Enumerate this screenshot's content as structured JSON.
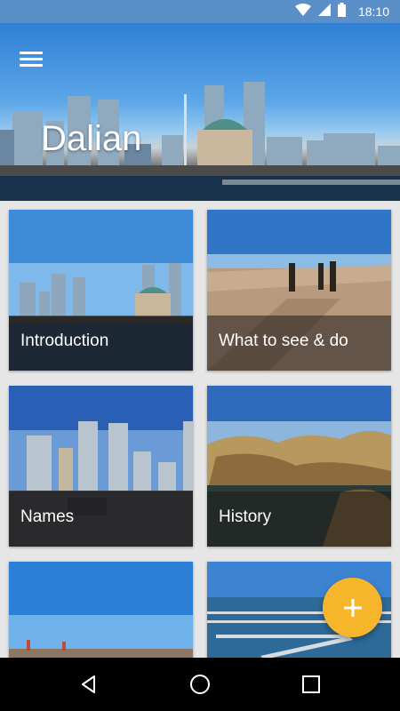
{
  "status_bar": {
    "time": "18:10",
    "icons": [
      "wifi-icon",
      "signal-icon",
      "battery-icon"
    ]
  },
  "header": {
    "title": "Dalian",
    "menu_icon": "hamburger-menu-icon"
  },
  "cards": [
    {
      "label": "Introduction"
    },
    {
      "label": "What to see & do"
    },
    {
      "label": "Names"
    },
    {
      "label": "History"
    },
    {
      "label": ""
    },
    {
      "label": ""
    }
  ],
  "fab": {
    "icon": "plus-icon",
    "color": "#f7b52c"
  },
  "nav_bar": {
    "buttons": [
      "back-icon",
      "home-icon",
      "recents-icon"
    ]
  },
  "colors": {
    "status_bar": "#5b8fc7",
    "accent": "#f7b52c",
    "background": "#e6e6e6"
  }
}
